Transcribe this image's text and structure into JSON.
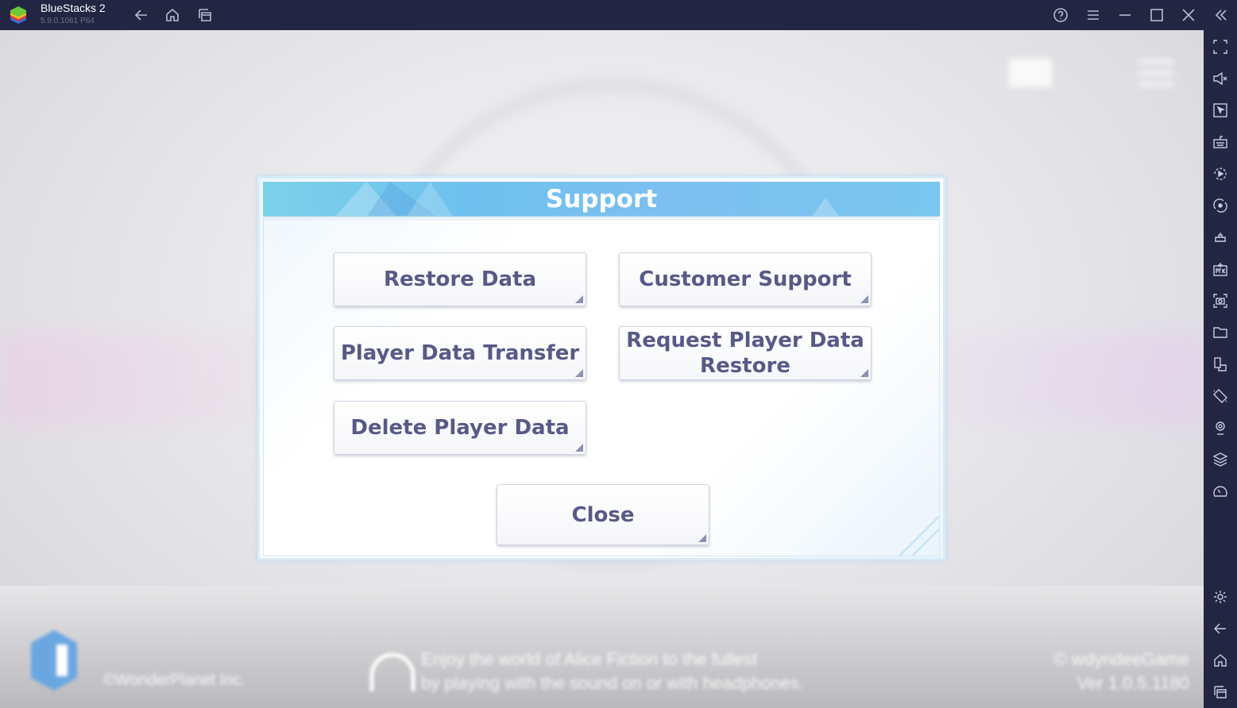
{
  "titlebar": {
    "app_name": "BlueStacks 2",
    "version": "5.9.0.1061  P64"
  },
  "dialog": {
    "title": "Support",
    "buttons": {
      "restore_data": "Restore Data",
      "customer_support": "Customer Support",
      "player_data_transfer": "Player Data Transfer",
      "request_restore_line1": "Request Player Data",
      "request_restore_line2": "Restore",
      "delete_player_data": "Delete Player Data",
      "close": "Close"
    }
  },
  "background": {
    "copyright": "©WonderPlanet Inc.",
    "notice_line1": "Enjoy the world of Alice Fiction to the fullest",
    "notice_line2": "by playing with the sound on or with headphones.",
    "version_line1": "© wdyndeeGame",
    "version_line2": "Ver 1.0.5.1180"
  },
  "colors": {
    "chrome": "#232642",
    "button_text": "#575987",
    "header": "#6ec0ee"
  }
}
